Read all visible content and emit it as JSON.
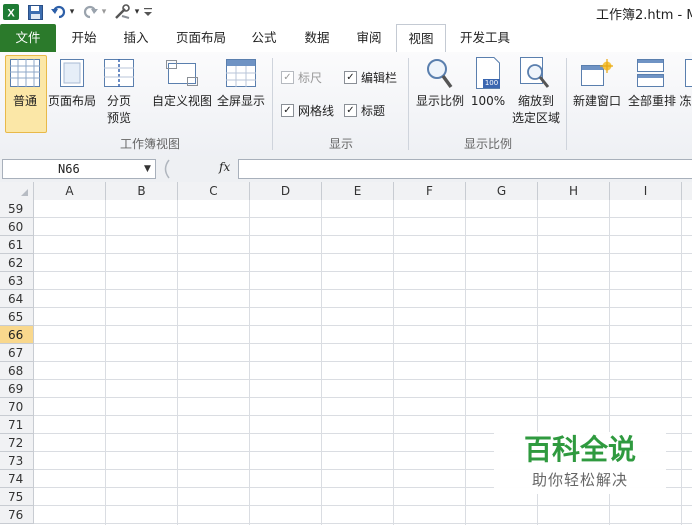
{
  "window": {
    "title": "工作簿2.htm - M"
  },
  "quick_access": {
    "menu_glyph": "▾"
  },
  "tabs": [
    {
      "label": "文件"
    },
    {
      "label": "开始"
    },
    {
      "label": "插入"
    },
    {
      "label": "页面布局"
    },
    {
      "label": "公式"
    },
    {
      "label": "数据"
    },
    {
      "label": "审阅"
    },
    {
      "label": "视图"
    },
    {
      "label": "开发工具"
    }
  ],
  "ribbon": {
    "workbook_views": {
      "group_label": "工作簿视图",
      "normal": "普通",
      "page_layout": "页面布局",
      "page_break_1": "分页",
      "page_break_2": "预览",
      "custom_views": "自定义视图",
      "full_screen": "全屏显示"
    },
    "show": {
      "group_label": "显示",
      "ruler": "标尺",
      "formula_bar": "编辑栏",
      "gridlines": "网格线",
      "headings": "标题"
    },
    "zoom": {
      "group_label": "显示比例",
      "zoom": "显示比例",
      "hundred": "100%",
      "zoom_sel_1": "缩放到",
      "zoom_sel_2": "选定区域",
      "icon_text": "100"
    },
    "window": {
      "new_window": "新建窗口",
      "arrange_all": "全部重排",
      "freeze": "冻"
    }
  },
  "formula_bar": {
    "name_box": "N66",
    "fx_label": "fx",
    "formula": ""
  },
  "columns": [
    "A",
    "B",
    "C",
    "D",
    "E",
    "F",
    "G",
    "H",
    "I"
  ],
  "rows": [
    "59",
    "60",
    "61",
    "62",
    "63",
    "64",
    "65",
    "66",
    "67",
    "68",
    "69",
    "70",
    "71",
    "72",
    "73",
    "74",
    "75",
    "76"
  ],
  "active_row": "66",
  "watermark": {
    "line1": "百科全说",
    "line2": "助你轻松解决"
  },
  "colors": {
    "file_tab": "#2b7a2b",
    "active_row_header": "#f9d88d",
    "watermark_green": "#2f9a3f"
  }
}
